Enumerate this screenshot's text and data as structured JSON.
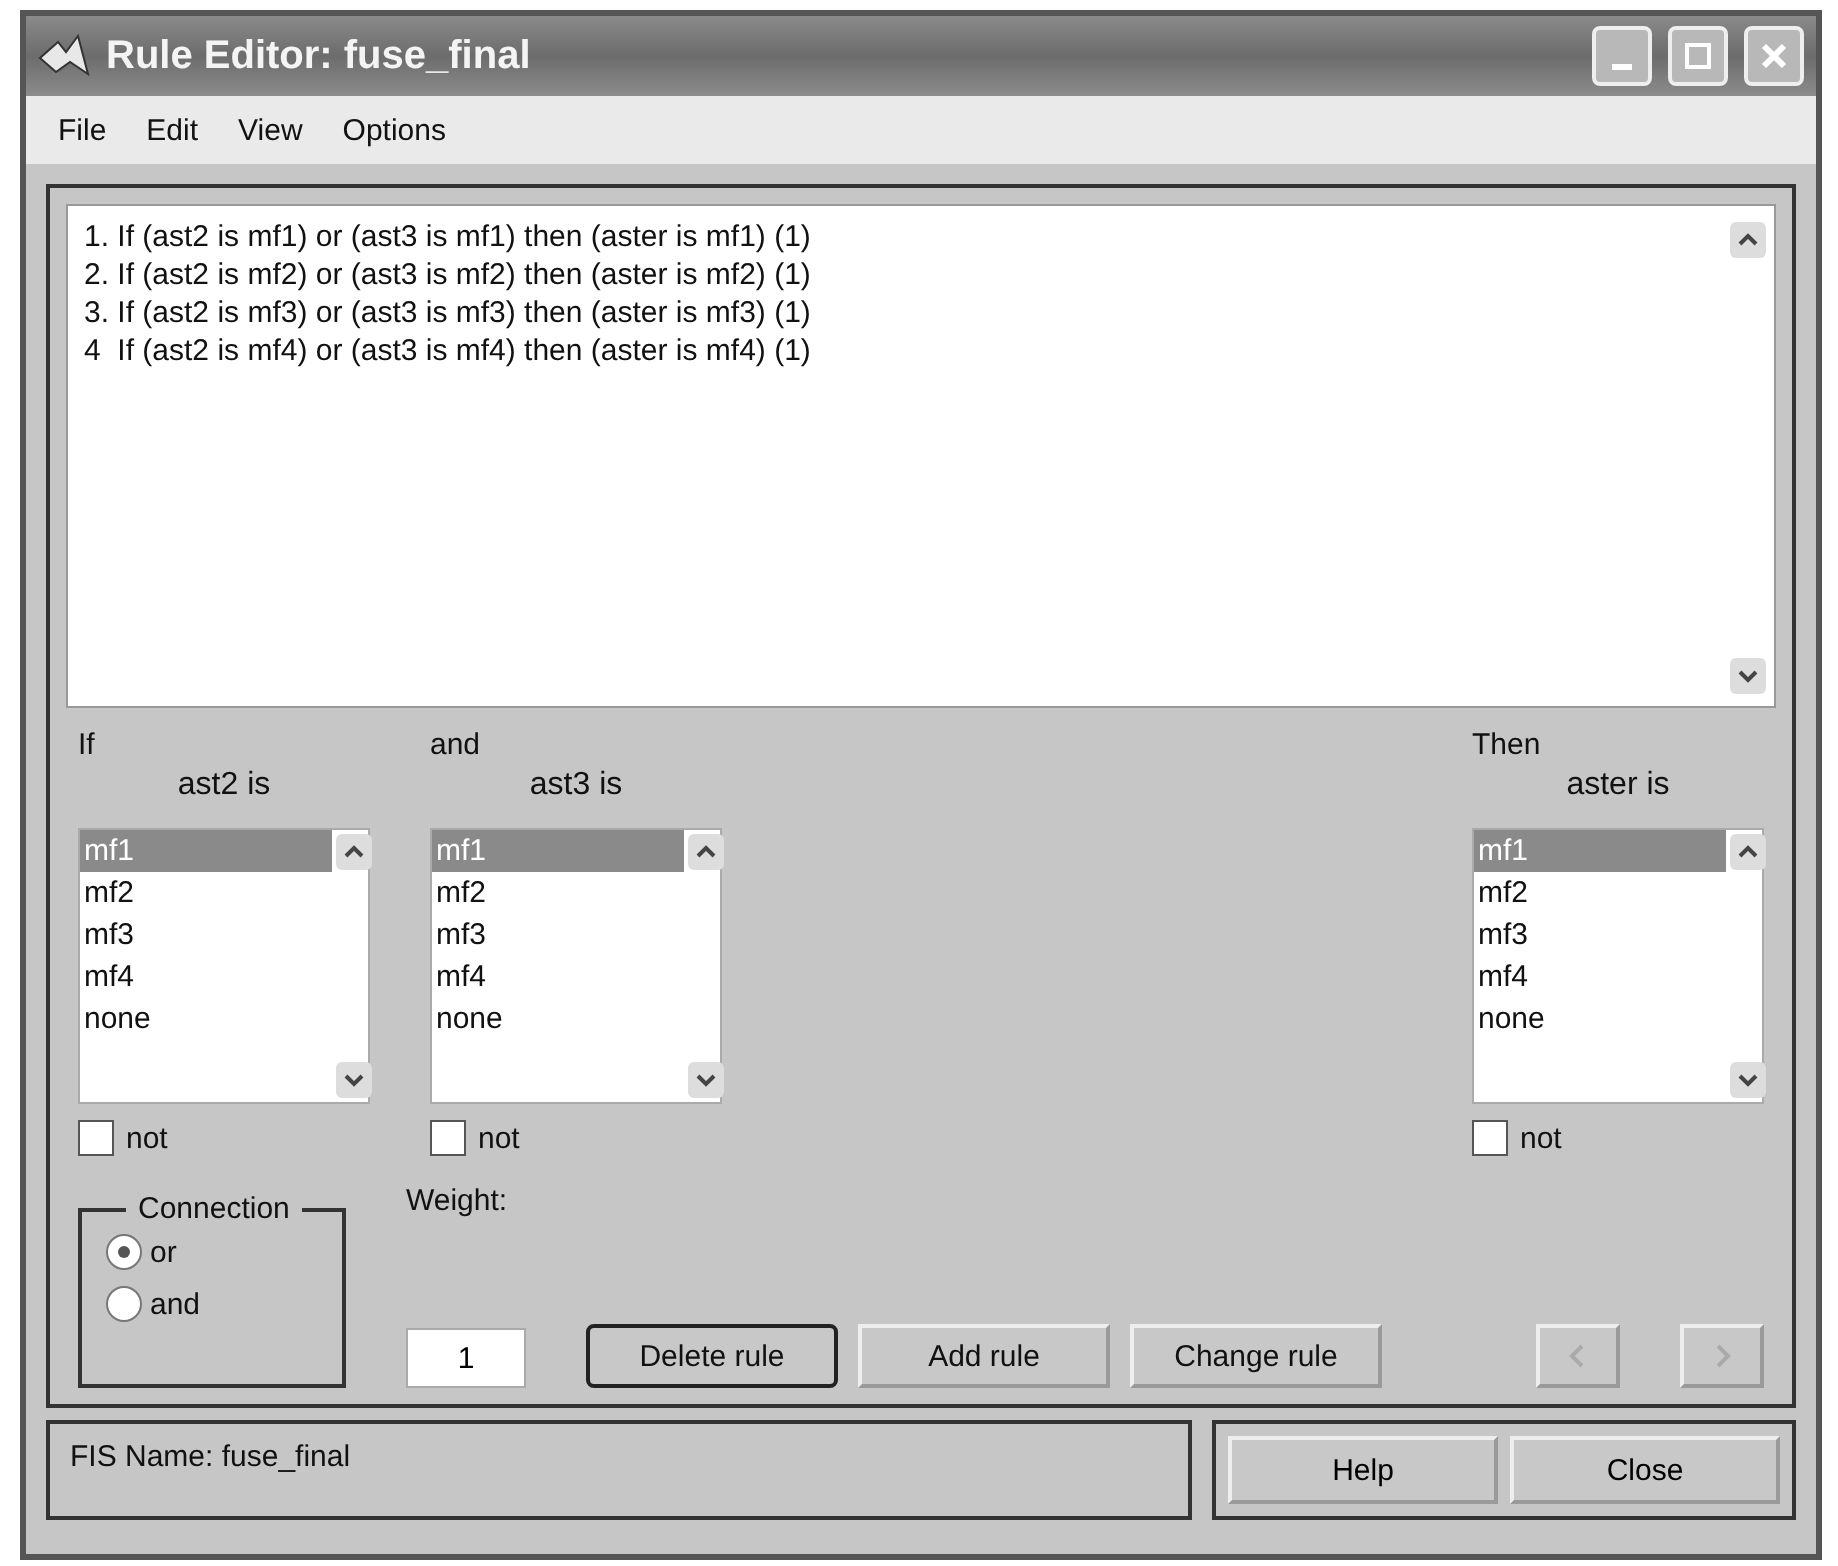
{
  "window": {
    "title": "Rule Editor: fuse_final"
  },
  "menu": [
    "File",
    "Edit",
    "View",
    "Options"
  ],
  "rules": [
    "1. If (ast2 is mf1) or (ast3 is mf1) then (aster is mf1) (1)",
    "2. If (ast2 is mf2) or (ast3 is mf2) then (aster is mf2) (1)",
    "3. If (ast2 is mf3) or (ast3 is mf3) then (aster is mf3) (1)",
    "4  If (ast2 is mf4) or (ast3 is mf4) then (aster is mf4) (1)"
  ],
  "antecedents": [
    {
      "connector": "If",
      "label": "ast2 is",
      "items": [
        {
          "label": "mf1",
          "selected": true
        },
        {
          "label": "mf2",
          "selected": false
        },
        {
          "label": "mf3",
          "selected": false
        },
        {
          "label": "mf4",
          "selected": false
        },
        {
          "label": "none",
          "selected": false
        }
      ],
      "not_label": "not",
      "not_checked": false
    },
    {
      "connector": "and",
      "label": "ast3 is",
      "items": [
        {
          "label": "mf1",
          "selected": true
        },
        {
          "label": "mf2",
          "selected": false
        },
        {
          "label": "mf3",
          "selected": false
        },
        {
          "label": "mf4",
          "selected": false
        },
        {
          "label": "none",
          "selected": false
        }
      ],
      "not_label": "not",
      "not_checked": false
    }
  ],
  "consequent": {
    "connector": "Then",
    "label": "aster is",
    "items": [
      {
        "label": "mf1",
        "selected": true
      },
      {
        "label": "mf2",
        "selected": false
      },
      {
        "label": "mf3",
        "selected": false
      },
      {
        "label": "mf4",
        "selected": false
      },
      {
        "label": "none",
        "selected": false
      }
    ],
    "not_label": "not",
    "not_checked": false
  },
  "connection": {
    "title": "Connection",
    "options": [
      {
        "label": "or",
        "selected": true
      },
      {
        "label": "and",
        "selected": false
      }
    ]
  },
  "weight": {
    "label": "Weight:",
    "value": "1"
  },
  "buttons": [
    {
      "label": "Delete rule",
      "focused": true
    },
    {
      "label": "Add rule",
      "focused": false
    },
    {
      "label": "Change rule",
      "focused": false
    }
  ],
  "nav_buttons": [
    {
      "kind": "prev",
      "disabled": true
    },
    {
      "kind": "next",
      "disabled": true
    }
  ],
  "status": "FIS Name: fuse_final",
  "footer_buttons": [
    "Help",
    "Close"
  ]
}
